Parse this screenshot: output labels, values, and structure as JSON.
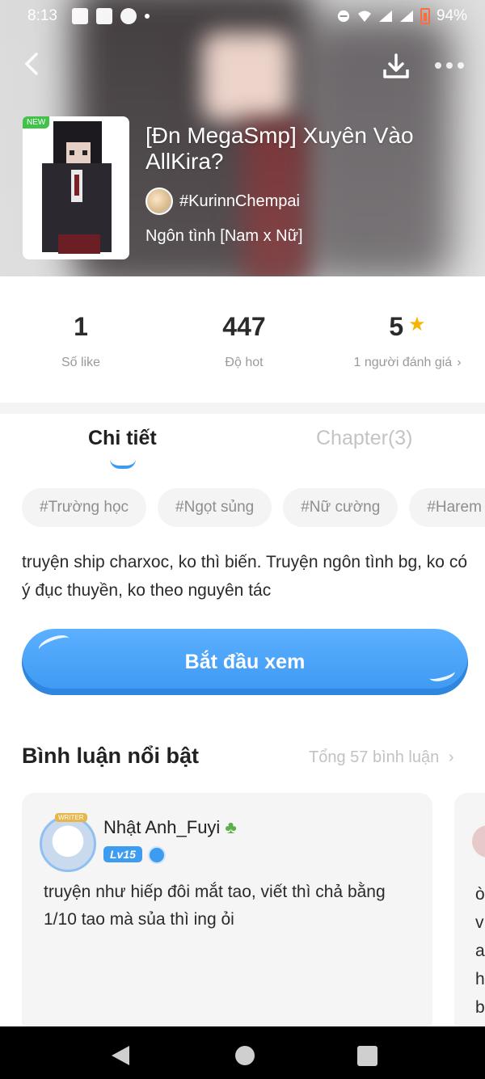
{
  "status_bar": {
    "time": "8:13",
    "battery": "94%"
  },
  "book": {
    "badge": "NEW",
    "title": "[Đn MegaSmp] Xuyên Vào AllKira?",
    "author": "#KurinnChempai",
    "genre": "Ngôn tình [Nam x Nữ]"
  },
  "stats": {
    "likes": {
      "value": "1",
      "label": "Số like"
    },
    "hot": {
      "value": "447",
      "label": "Độ hot"
    },
    "rating": {
      "value": "5",
      "label": "1 người đánh giá",
      "chevron": "›"
    }
  },
  "tabs": {
    "detail": "Chi tiết",
    "chapters": "Chapter(3)"
  },
  "tags": [
    "#Trường học",
    "#Ngọt sủng",
    "#Nữ cường",
    "#Harem"
  ],
  "description": "truyện ship charxoc, ko thì biến. Truyện ngôn tình bg, ko có ý đục thuyền, ko theo nguyên tác",
  "start_button": "Bắt đầu xem",
  "comments_section": {
    "title": "Bình luận nổi bật",
    "total": "Tổng 57 bình luận",
    "chevron": "›",
    "comments": [
      {
        "user": "Nhật Anh_Fuyi",
        "avatar_badge": "WRITER",
        "level": "Lv15",
        "text": "truyện như hiếp đôi mắt tao, viết thì chả bằng 1/10 tao mà sủa thì ing ỏi"
      }
    ],
    "next_card_peek": "ò v a h b"
  },
  "colors": {
    "accent": "#3d9bf0",
    "star": "#f7b500",
    "new_badge": "#43c24a"
  }
}
